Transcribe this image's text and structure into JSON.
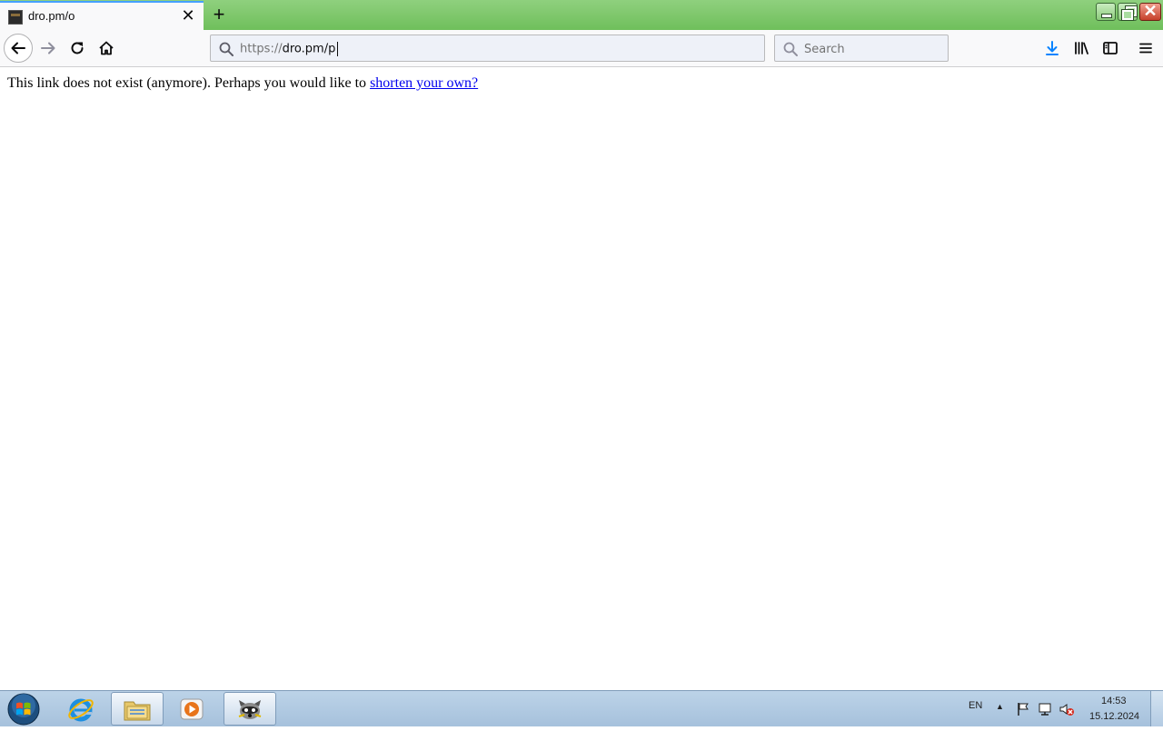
{
  "browser": {
    "tab": {
      "title": "dro.pm/o"
    },
    "urlbar": {
      "scheme": "https://",
      "host_path": "dro.pm/p"
    },
    "searchbar": {
      "placeholder": "Search"
    }
  },
  "page": {
    "message": "This link does not exist (anymore). Perhaps you would like to",
    "link_text": "shorten your own?"
  },
  "taskbar": {
    "items": [
      "internet-explorer",
      "windows-explorer",
      "media-player",
      "raccoon-app"
    ],
    "language": "EN",
    "time": "14:53",
    "date": "15.12.2024"
  },
  "colors": {
    "titlebar": "#6fbf5b",
    "tab_accent": "#45a1ff",
    "link": "#0000ee",
    "download_icon": "#0a84ff"
  }
}
